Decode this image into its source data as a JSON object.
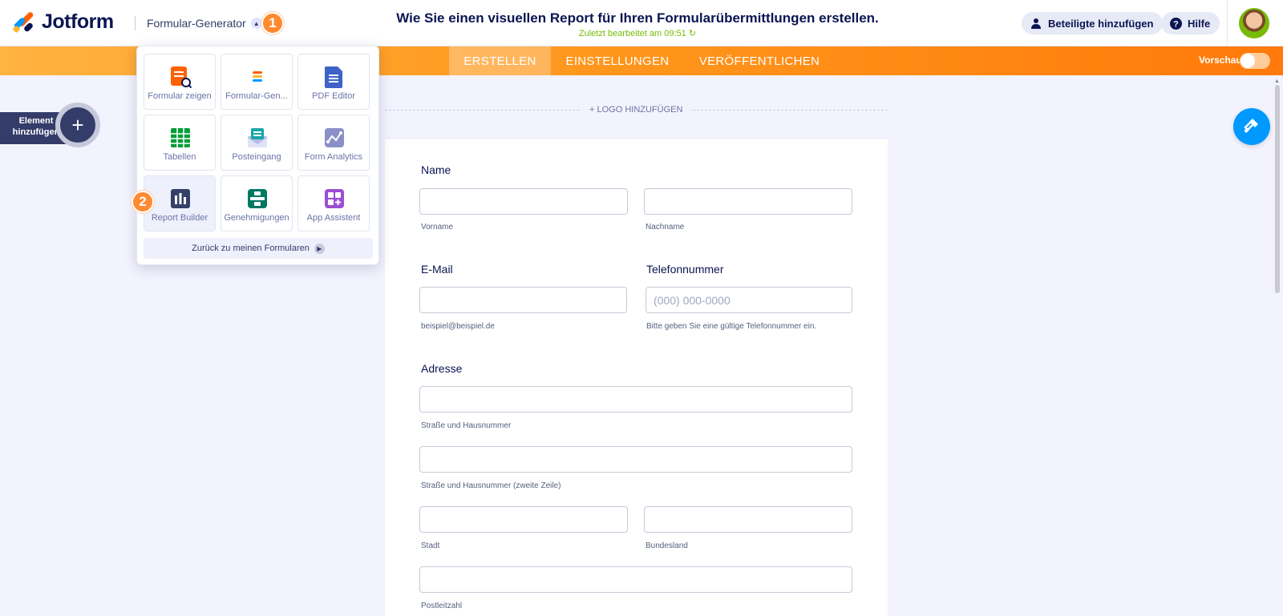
{
  "header": {
    "brand": "Jotform",
    "app_switcher": "Formular-Generator",
    "title": "Wie Sie einen visuellen Report für Ihren Formularübermittlungen erstellen.",
    "last_edited": "Zuletzt bearbeitet am 09:51",
    "add_participants": "Beteiligte hinzufügen",
    "help": "Hilfe",
    "step1": "1"
  },
  "nav": {
    "tabs": [
      "ERSTELLEN",
      "EINSTELLUNGEN",
      "VERÖFFENTLICHEN"
    ],
    "preview": "Vorschau"
  },
  "sidebar": {
    "add_element_line1": "Element",
    "add_element_line2": "hinzufügen"
  },
  "dropdown": {
    "tiles": [
      {
        "label": "Formular zeigen",
        "icon": "form-view-icon"
      },
      {
        "label": "Formular-Gen...",
        "icon": "form-builder-icon"
      },
      {
        "label": "PDF Editor",
        "icon": "pdf-editor-icon"
      },
      {
        "label": "Tabellen",
        "icon": "tables-icon"
      },
      {
        "label": "Posteingang",
        "icon": "inbox-icon"
      },
      {
        "label": "Form Analytics",
        "icon": "analytics-icon"
      },
      {
        "label": "Report Builder",
        "icon": "report-builder-icon"
      },
      {
        "label": "Genehmigungen",
        "icon": "approvals-icon"
      },
      {
        "label": "App Assistent",
        "icon": "app-assistant-icon"
      }
    ],
    "back_label": "Zurück zu meinen Formularen",
    "step2": "2"
  },
  "form": {
    "logo_add": "+ LOGO HINZUFÜGEN",
    "name_label": "Name",
    "first_name_sub": "Vorname",
    "last_name_sub": "Nachname",
    "email_label": "E-Mail",
    "email_sub": "beispiel@beispiel.de",
    "phone_label": "Telefonnummer",
    "phone_placeholder": "(000) 000-0000",
    "phone_sub": "Bitte geben Sie eine gültige Telefonnummer ein.",
    "address_label": "Adresse",
    "street_sub": "Straße und Hausnummer",
    "street2_sub": "Straße und Hausnummer (zweite Zeile)",
    "city_sub": "Stadt",
    "state_sub": "Bundesland",
    "zip_sub": "Postleitzahl"
  },
  "colors": {
    "accent_orange": "#ff7a0a",
    "brand_navy": "#0a1551",
    "edited_green": "#78bb07",
    "paint_blue": "#0099ff"
  }
}
